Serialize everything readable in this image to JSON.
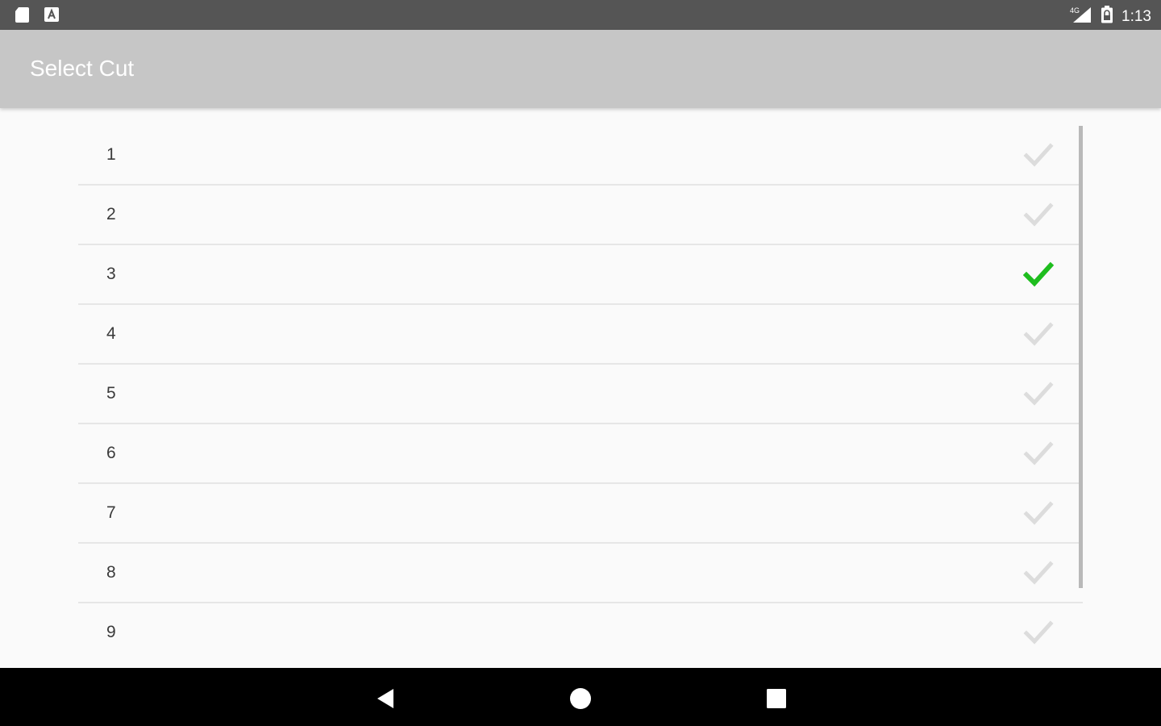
{
  "status_bar": {
    "left_icons": [
      "sd-card-icon",
      "a-notification-icon"
    ],
    "right_icons": [
      "signal-4g-icon",
      "battery-icon"
    ],
    "time": "1:13"
  },
  "app_bar": {
    "title": "Select Cut"
  },
  "list": {
    "items": [
      {
        "label": "1",
        "selected": false
      },
      {
        "label": "2",
        "selected": false
      },
      {
        "label": "3",
        "selected": true
      },
      {
        "label": "4",
        "selected": false
      },
      {
        "label": "5",
        "selected": false
      },
      {
        "label": "6",
        "selected": false
      },
      {
        "label": "7",
        "selected": false
      },
      {
        "label": "8",
        "selected": false
      },
      {
        "label": "9",
        "selected": false
      }
    ]
  },
  "colors": {
    "status_bar": "#555555",
    "app_bar": "#c6c6c6",
    "check_selected": "#1ebd1e",
    "check_unselected": "#dcdcdc",
    "nav_bar": "#000000"
  },
  "nav_bar": {
    "buttons": [
      "back-icon",
      "home-icon",
      "recents-icon"
    ]
  }
}
